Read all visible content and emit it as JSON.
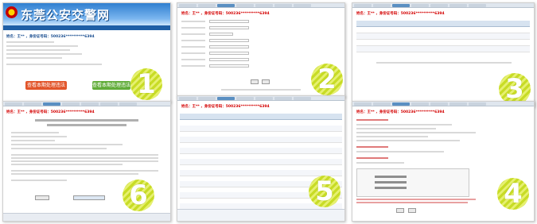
{
  "site_title": "东莞公安交警网",
  "id_line": "姓名：王** ，身份证号码：500236**********6394",
  "red_buttons": {
    "left": "查看本期处理违法",
    "right": "查看本期处理违法"
  },
  "step_badges": [
    "1",
    "2",
    "3",
    "4",
    "5",
    "6"
  ]
}
